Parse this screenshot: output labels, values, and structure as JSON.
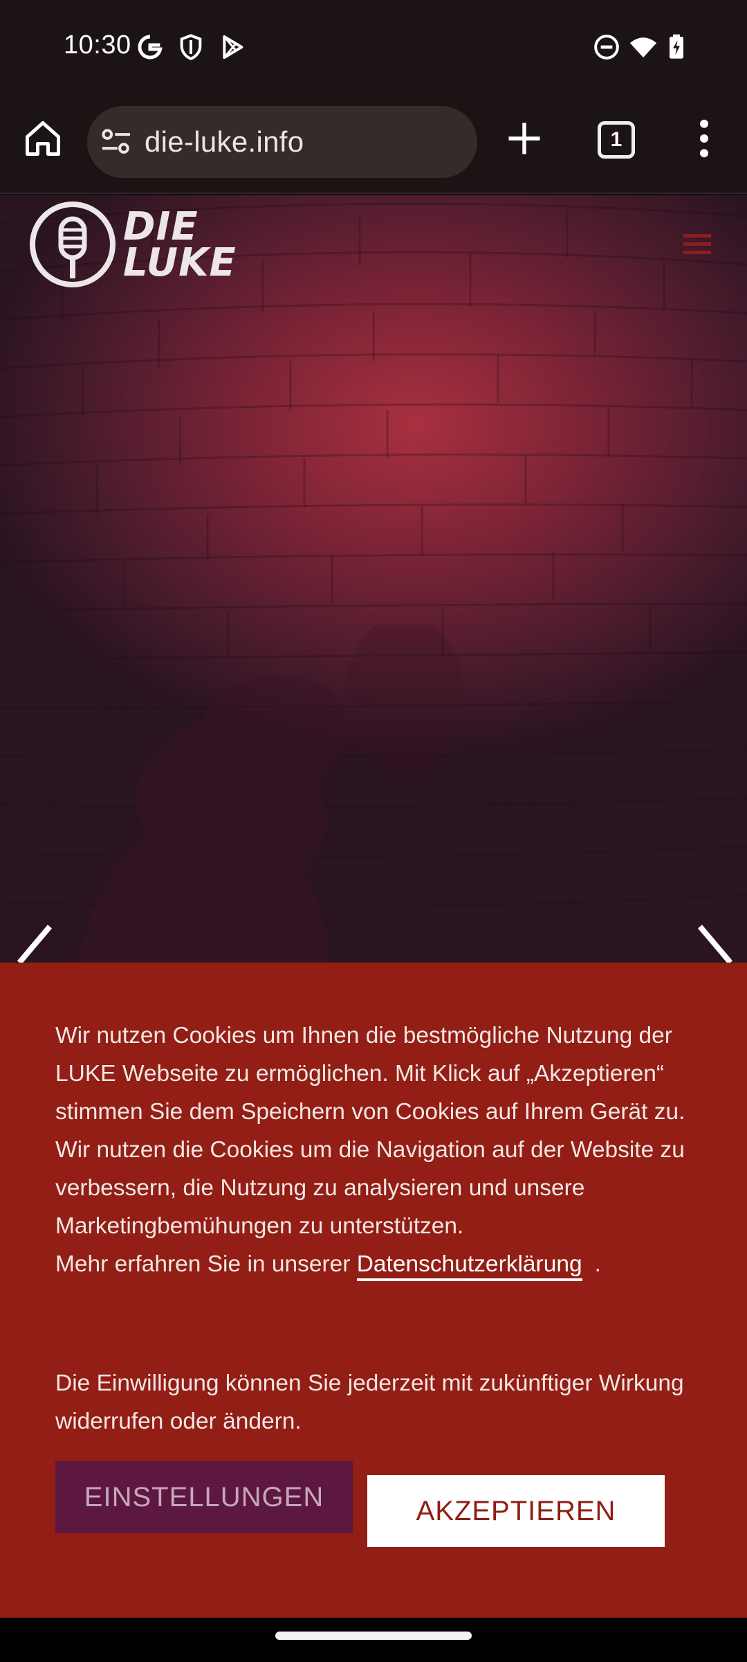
{
  "status_bar": {
    "time": "10:30",
    "icons_left": [
      "google-icon",
      "shield-icon",
      "play-store-icon"
    ],
    "icons_right": [
      "do-not-disturb-icon",
      "wifi-icon",
      "battery-charging-icon"
    ]
  },
  "browser": {
    "url": "die-luke.info",
    "tab_count": "1"
  },
  "site": {
    "logo_line1": "DIE",
    "logo_line2": "LUKE"
  },
  "cookie_banner": {
    "paragraph1": "Wir nutzen Cookies um Ihnen die bestmögliche Nutzung der LUKE Webseite zu ermöglichen. Mit Klick auf „Akzeptieren“ stimmen Sie dem Speichern von Cookies auf Ihrem Gerät zu.",
    "paragraph2": "Wir nutzen die Cookies um die Navigation auf der Website zu verbessern, die Nutzung zu analysieren und unsere Marketingbemühungen zu unterstützen.",
    "more_info_prefix": "Mehr erfahren Sie in unserer ",
    "privacy_link": "Datenschutzerklärung",
    "more_info_suffix": ".",
    "consent_note": "Die Einwilligung können Sie jederzeit mit zukünftiger Wirkung widerrufen oder ändern.",
    "settings_label": "EINSTELLUNGEN",
    "accept_label": "AKZEPTIEREN"
  },
  "colors": {
    "banner_bg": "#921e15",
    "settings_bg": "#5c1840",
    "accept_text": "#8e1e16"
  }
}
